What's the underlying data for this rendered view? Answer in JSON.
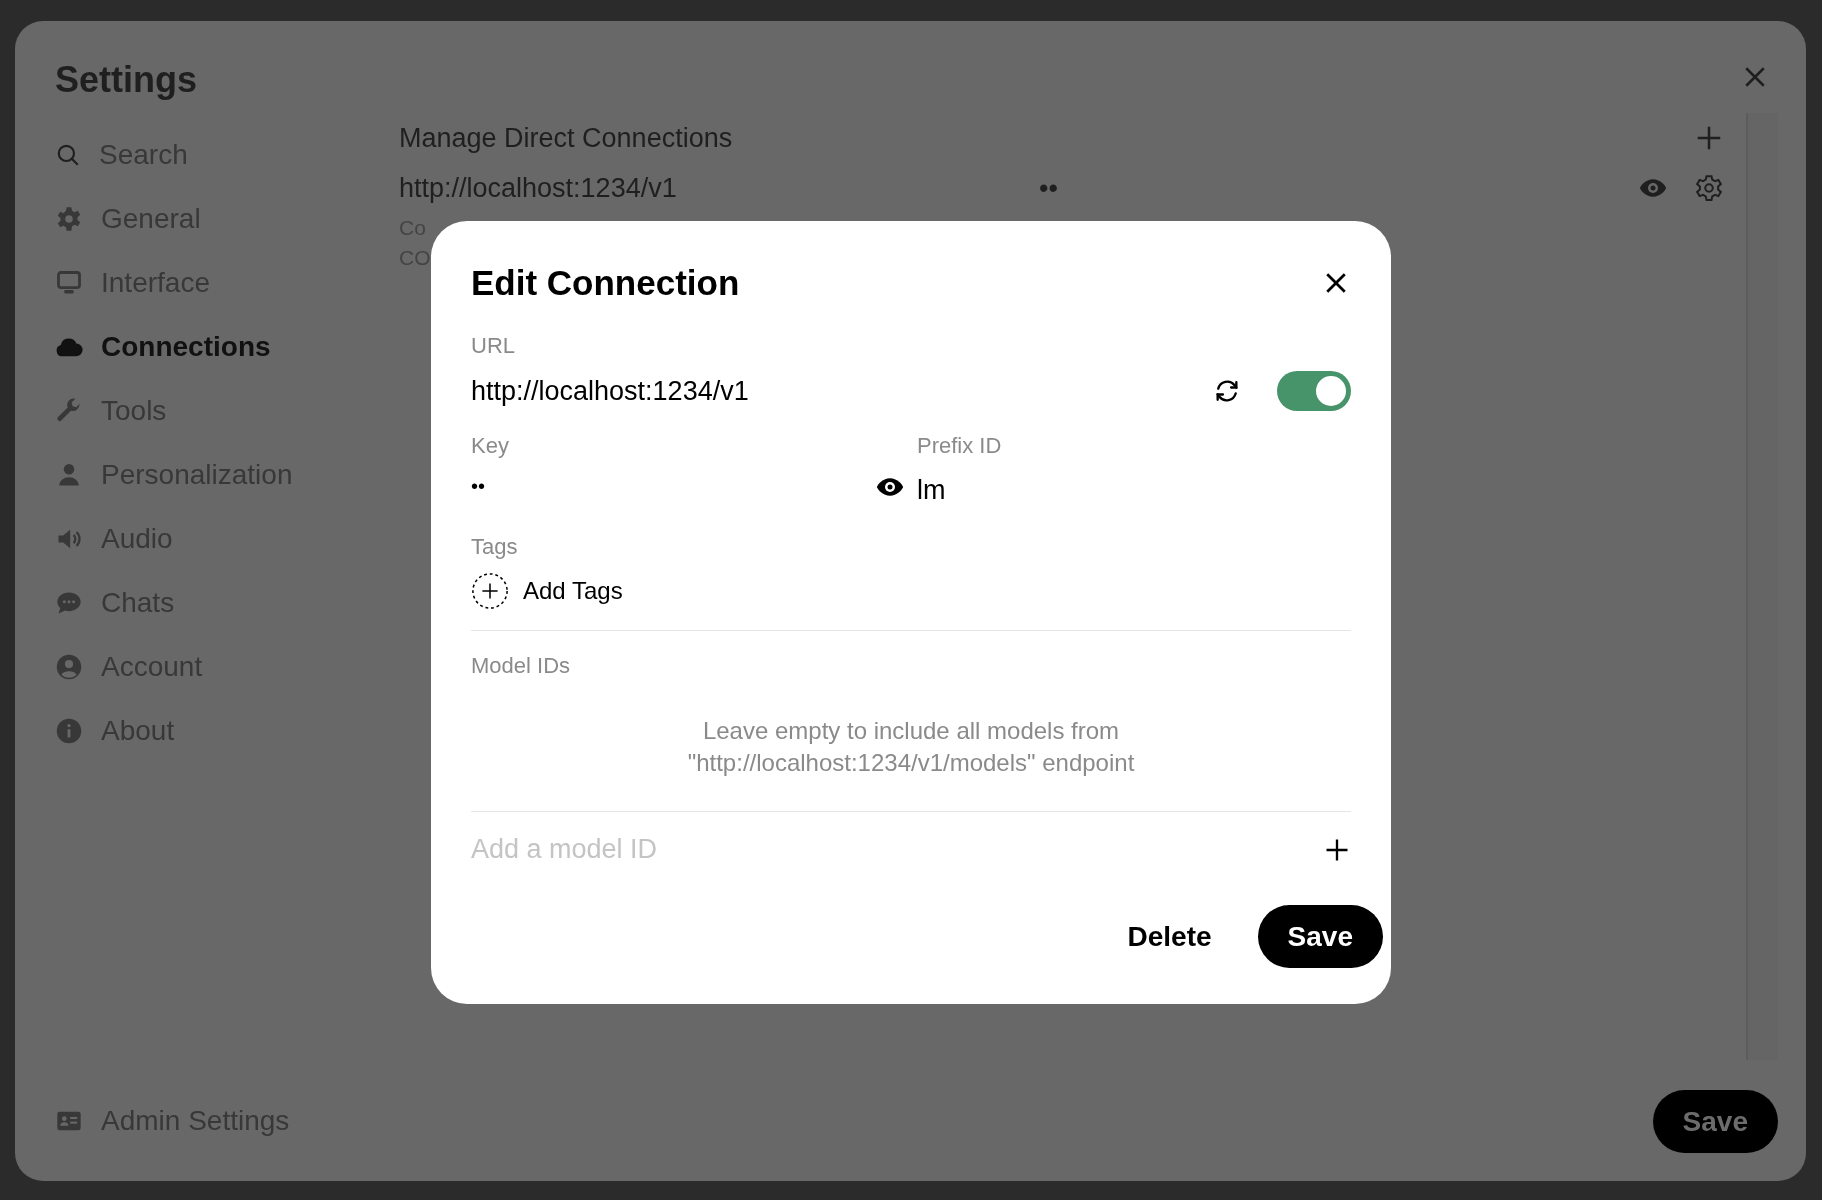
{
  "settings": {
    "title": "Settings",
    "search": {
      "placeholder": "Search"
    },
    "sidebar": {
      "items": [
        {
          "label": "General",
          "selected": false
        },
        {
          "label": "Interface",
          "selected": false
        },
        {
          "label": "Connections",
          "selected": true
        },
        {
          "label": "Tools",
          "selected": false
        },
        {
          "label": "Personalization",
          "selected": false
        },
        {
          "label": "Audio",
          "selected": false
        },
        {
          "label": "Chats",
          "selected": false
        },
        {
          "label": "Account",
          "selected": false
        },
        {
          "label": "About",
          "selected": false
        }
      ],
      "footer": {
        "label": "Admin Settings"
      }
    },
    "content": {
      "heading": "Manage Direct Connections",
      "connection": {
        "url": "http://localhost:1234/v1",
        "key": "••"
      },
      "cut_lines": [
        "Co",
        "CO"
      ]
    },
    "save_button": "Save"
  },
  "modal": {
    "title": "Edit Connection",
    "url": {
      "label": "URL",
      "value": "http://localhost:1234/v1",
      "enabled": true
    },
    "key": {
      "label": "Key",
      "value": "••"
    },
    "prefix_id": {
      "label": "Prefix ID",
      "value": "lm"
    },
    "tags": {
      "label": "Tags",
      "add_label": "Add Tags"
    },
    "model_ids": {
      "label": "Model IDs",
      "hint": "Leave empty to include all models from \"http://localhost:1234/v1/models\" endpoint",
      "placeholder": "Add a model ID"
    },
    "buttons": {
      "delete": "Delete",
      "save": "Save"
    }
  }
}
